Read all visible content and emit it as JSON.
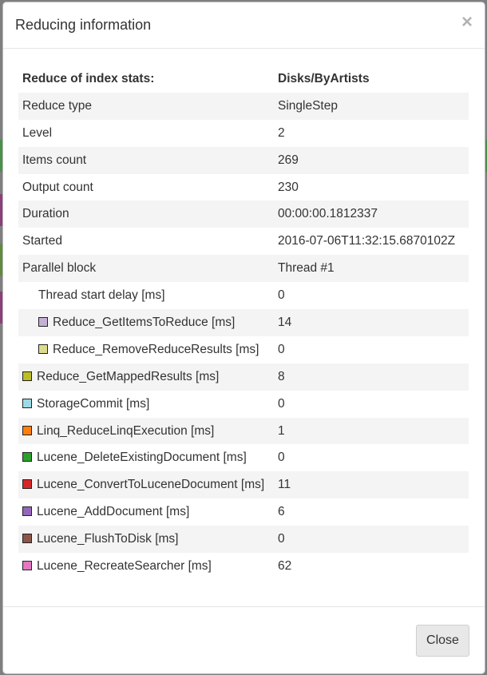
{
  "dialog": {
    "title": "Reducing information",
    "close_symbol": "×",
    "close_button_label": "Close"
  },
  "header": {
    "label": "Reduce of index stats:",
    "value": "Disks/ByArtists"
  },
  "rows": [
    {
      "label": "Reduce type",
      "value": "SingleStep"
    },
    {
      "label": "Level",
      "value": "2"
    },
    {
      "label": "Items count",
      "value": "269"
    },
    {
      "label": "Output count",
      "value": "230"
    },
    {
      "label": "Duration",
      "value": "00:00:00.1812337"
    },
    {
      "label": "Started",
      "value": "2016-07-06T11:32:15.6870102Z"
    },
    {
      "label": "Parallel block",
      "value": "Thread #1"
    },
    {
      "label": "Thread start delay [ms]",
      "value": "0"
    },
    {
      "label": "Reduce_GetItemsToReduce [ms]",
      "value": "14",
      "color": "#c5b0d5"
    },
    {
      "label": "Reduce_RemoveReduceResults [ms]",
      "value": "0",
      "color": "#dbdb8d"
    },
    {
      "label": "Reduce_GetMappedResults [ms]",
      "value": "8",
      "color": "#bcbd22"
    },
    {
      "label": "StorageCommit [ms]",
      "value": "0",
      "color": "#9edae5"
    },
    {
      "label": "Linq_ReduceLinqExecution [ms]",
      "value": "1",
      "color": "#ff7f0e"
    },
    {
      "label": "Lucene_DeleteExistingDocument [ms]",
      "value": "0",
      "color": "#2ca02c"
    },
    {
      "label": "Lucene_ConvertToLuceneDocument [ms]",
      "value": "11",
      "color": "#d62728"
    },
    {
      "label": "Lucene_AddDocument [ms]",
      "value": "6",
      "color": "#9467bd"
    },
    {
      "label": "Lucene_FlushToDisk [ms]",
      "value": "0",
      "color": "#8c564b"
    },
    {
      "label": "Lucene_RecreateSearcher [ms]",
      "value": "62",
      "color": "#e377c2"
    }
  ]
}
